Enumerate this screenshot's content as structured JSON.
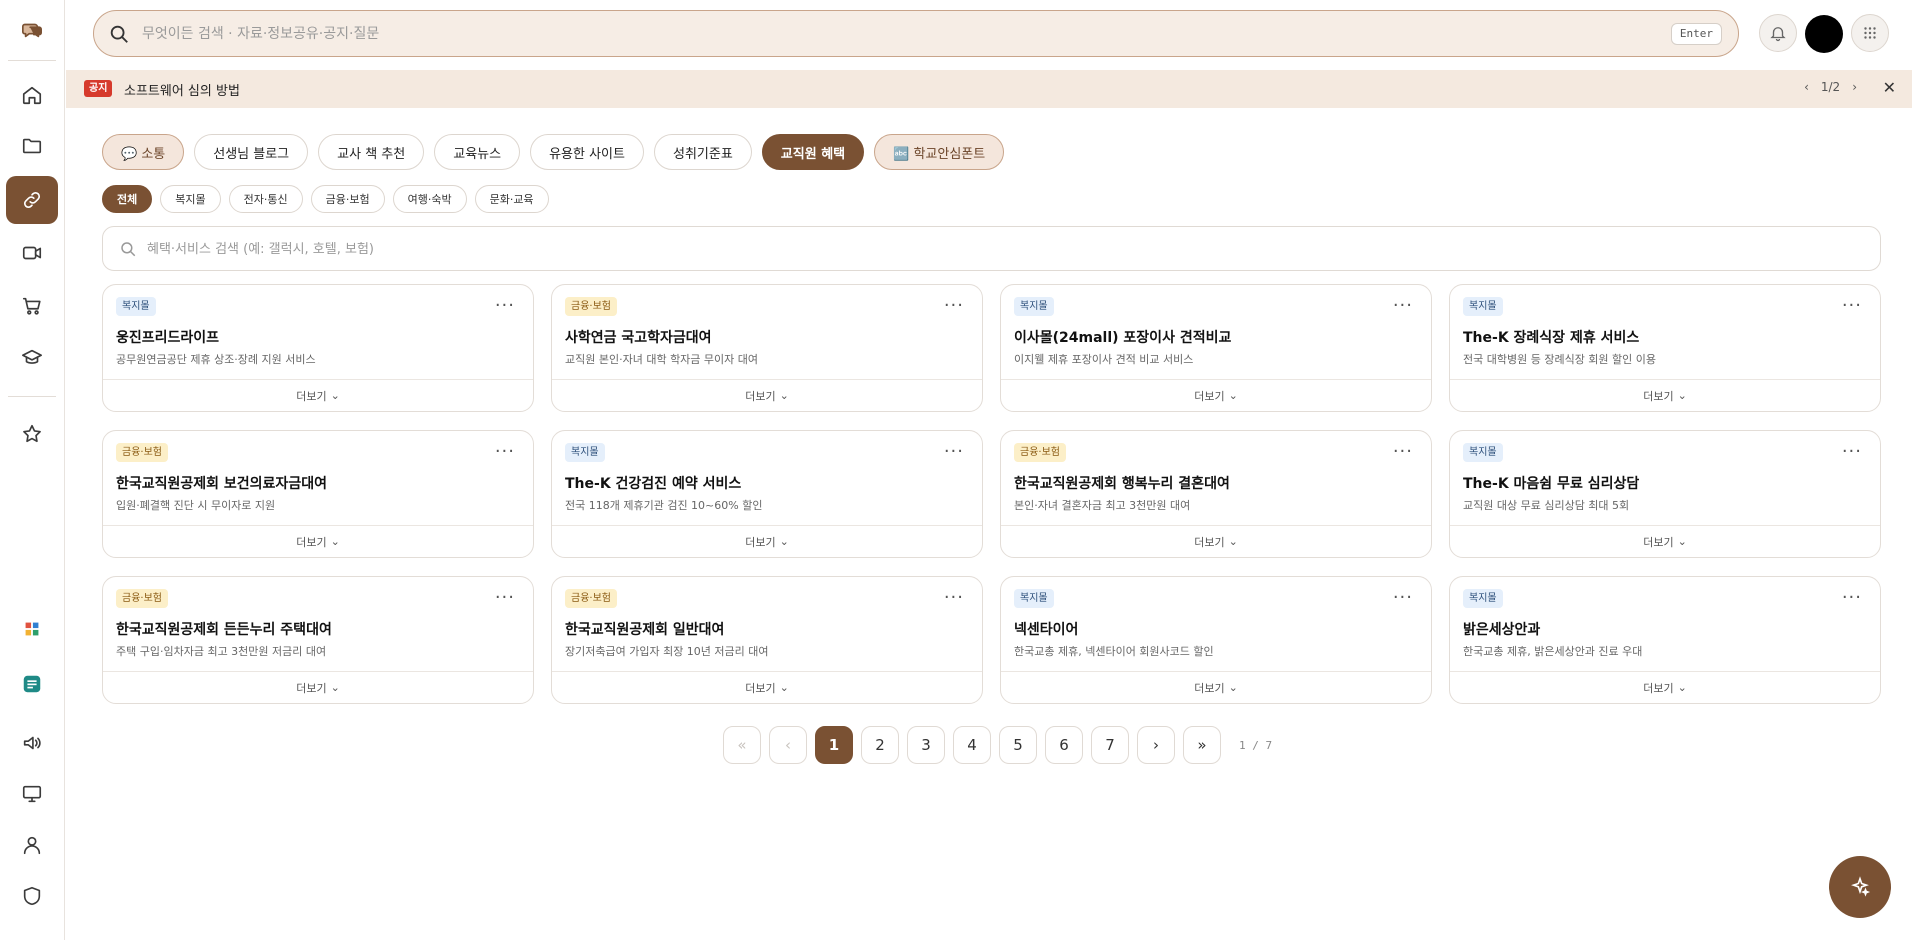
{
  "header": {
    "search_placeholder": "무엇이든 검색 · 자료·정보공유·공지·질문",
    "enter_key": "Enter"
  },
  "notice": {
    "badge": "공지",
    "text": "소프트웨어 심의 방법",
    "page": "1/2",
    "close": "✕"
  },
  "tabs": [
    {
      "label": "💬 소통"
    },
    {
      "label": "선생님 블로그"
    },
    {
      "label": "교사 책 추천"
    },
    {
      "label": "교육뉴스"
    },
    {
      "label": "유용한 사이트"
    },
    {
      "label": "성취기준표"
    },
    {
      "label": "교직원 혜택"
    },
    {
      "label": "🔤 학교안심폰트"
    }
  ],
  "subtabs": [
    {
      "label": "전체"
    },
    {
      "label": "복지몰"
    },
    {
      "label": "전자·통신"
    },
    {
      "label": "금융·보험"
    },
    {
      "label": "여행·숙박"
    },
    {
      "label": "문화·교육"
    }
  ],
  "benefit_search": {
    "placeholder": "혜택·서비스 검색 (예: 갤럭시, 호텔, 보험)"
  },
  "card_more_label": "더보기",
  "cards": [
    {
      "badge": "복지몰",
      "title": "웅진프리드라이프",
      "desc": "공무원연금공단 제휴 상조·장례 지원 서비스"
    },
    {
      "badge": "금융·보험",
      "title": "사학연금 국고학자금대여",
      "desc": "교직원 본인·자녀 대학 학자금 무이자 대여"
    },
    {
      "badge": "복지몰",
      "title": "이사몰(24mall) 포장이사 견적비교",
      "desc": "이지웰 제휴 포장이사 견적 비교 서비스"
    },
    {
      "badge": "복지몰",
      "title": "The-K 장례식장 제휴 서비스",
      "desc": "전국 대학병원 등 장례식장 회원 할인 이용"
    },
    {
      "badge": "금융·보험",
      "title": "한국교직원공제회 보건의료자금대여",
      "desc": "입원·폐결핵 진단 시 무이자로 지원"
    },
    {
      "badge": "복지몰",
      "title": "The-K 건강검진 예약 서비스",
      "desc": "전국 118개 제휴기관 검진 10~60% 할인"
    },
    {
      "badge": "금융·보험",
      "title": "한국교직원공제회 행복누리 결혼대여",
      "desc": "본인·자녀 결혼자금 최고 3천만원 대여"
    },
    {
      "badge": "복지몰",
      "title": "The-K 마음쉼 무료 심리상담",
      "desc": "교직원 대상 무료 심리상담 최대 5회"
    },
    {
      "badge": "금융·보험",
      "title": "한국교직원공제회 든든누리 주택대여",
      "desc": "주택 구입·임차자금 최고 3천만원 저금리 대여"
    },
    {
      "badge": "금융·보험",
      "title": "한국교직원공제회 일반대여",
      "desc": "장기저축급여 가입자 최장 10년 저금리 대여"
    },
    {
      "badge": "복지몰",
      "title": "넥센타이어",
      "desc": "한국교총 제휴, 넥센타이어 회원사코드 할인"
    },
    {
      "badge": "복지몰",
      "title": "밝은세상안과",
      "desc": "한국교총 제휴, 밝은세상안과 진료 우대"
    }
  ],
  "pagination": {
    "first": "«",
    "prev": "‹",
    "pages": [
      "1",
      "2",
      "3",
      "4",
      "5",
      "6",
      "7"
    ],
    "next": "›",
    "last": "»",
    "info": "1 / 7"
  },
  "colors": {
    "brand": "#7a5133",
    "notice_bg": "#f4e9df",
    "notice_badge": "#d63a2c",
    "badge_welfare": "#e5effb",
    "badge_finance": "#fcefc8"
  }
}
